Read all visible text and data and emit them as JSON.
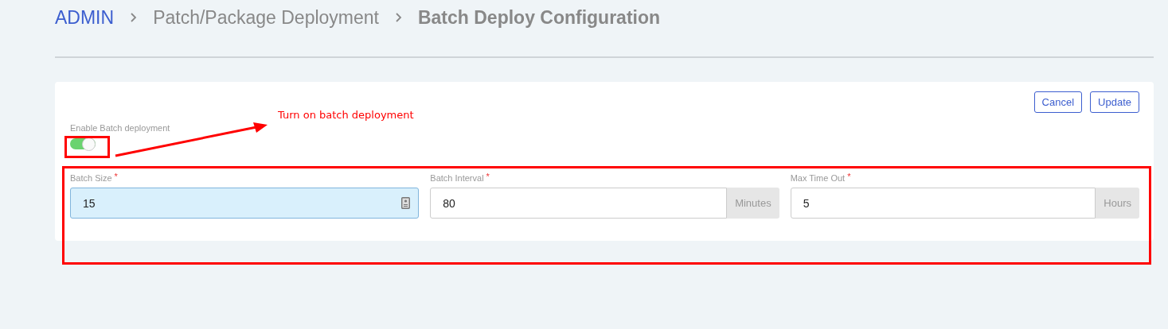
{
  "breadcrumb": [
    {
      "label": "ADMIN",
      "kind": "link"
    },
    {
      "label": "Patch/Package Deployment",
      "kind": "page"
    },
    {
      "label": "Batch Deploy Configuration",
      "kind": "current"
    }
  ],
  "buttons": [
    "Cancel",
    "Update"
  ],
  "toggle": {
    "label": "Enable Batch deployment",
    "on": true
  },
  "fields": [
    {
      "label": "Batch Size",
      "required_mark": "*",
      "value": "15",
      "focused": true,
      "kind": "autofill"
    },
    {
      "label": "Batch Interval",
      "required_mark": "*",
      "value": "80",
      "focused": false,
      "kind": "unit",
      "unit": "Minutes"
    },
    {
      "label": "Max Time Out",
      "required_mark": "*",
      "value": "5",
      "focused": false,
      "kind": "unit",
      "unit": "Hours"
    }
  ],
  "annotation": {
    "text": "Turn on batch deployment"
  }
}
